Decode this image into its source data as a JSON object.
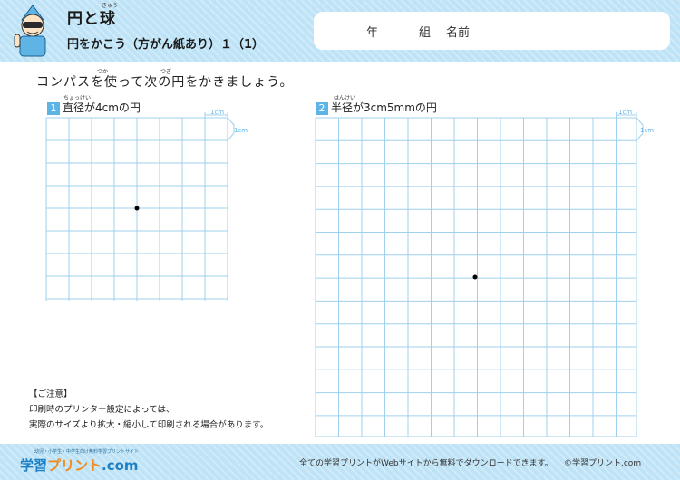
{
  "header": {
    "title": "円と球",
    "title_ruby": "きゅう",
    "subtitle": "円をかこう（方がん紙あり）１（1）"
  },
  "namebox": {
    "year_label": "年",
    "class_label": "組",
    "name_label": "名前"
  },
  "instruction": {
    "text": "コンパスを使って次の円をかきましょう。",
    "ruby_tsuka": "つか",
    "ruby_tsugi": "つぎ"
  },
  "questions": [
    {
      "number": "1",
      "label": "直径が4cmの円",
      "ruby": "ちょっけい"
    },
    {
      "number": "2",
      "label": "半径が3cm5mmの円",
      "ruby": "はんけい"
    }
  ],
  "grid_labels": {
    "unit_top": "1cm",
    "unit_side": "1cm"
  },
  "notice": {
    "heading": "【ご注意】",
    "line1": "印刷時のプリンター設定によっては、",
    "line2": "実際のサイズより拡大・縮小して印刷される場合があります。"
  },
  "footer": {
    "logo_tagline": "幼児・小学生・中学生向け無料学習プリントサイト",
    "logo_text_1": "学習",
    "logo_text_2": "プリント",
    "logo_text_3": ".com",
    "message": "全ての学習プリントがWebサイトから無料でダウンロードできます。",
    "site": "©学習プリント.com"
  },
  "colors": {
    "header_bg": "#bfe3f6",
    "accent": "#5fb4e6",
    "grid_line": "#9fd0ee"
  }
}
